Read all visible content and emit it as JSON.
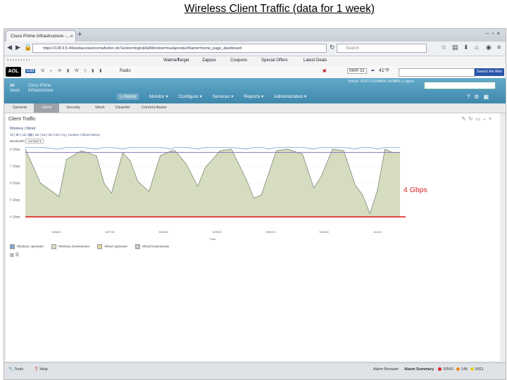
{
  "slide_title": "Wireless Client Traffic (data for 1 week)",
  "browser": {
    "tab_title": "Cisco Prime Infrastructure -...",
    "new_tab": "+",
    "url": "https://128.9.5.44/webacs/welcomeAction.do?action=login&failWindow=true&productName=home_page_dashboard",
    "search_placeholder": "Search"
  },
  "bookmarks": [
    "Walmart",
    "Target",
    "Zappos",
    "Coupons",
    "Special Offers",
    "Latest Deals"
  ],
  "aol_toolbar": {
    "logo": "AOL",
    "edit": "Edit",
    "radio": "Radio",
    "date": "MAR 31",
    "weather": "41°F",
    "search_button": "Search the Web"
  },
  "app_header": {
    "logo": "cisco",
    "product": "Cisco Prime Infrastructure",
    "user_info": "Virtual : ROOT-DOMAIN  |  ADMIN  |  Logout",
    "menu": [
      "Home",
      "Monitor",
      "Configure",
      "Services",
      "Reports",
      "Administration"
    ]
  },
  "subtabs": [
    "General",
    "Client",
    "Security",
    "Mesh",
    "CleanAir",
    "Context Aware"
  ],
  "panel": {
    "title": "Client Traffic",
    "filters": [
      "Wireless",
      "Wired"
    ],
    "periods": [
      "1h",
      "6h",
      "1d",
      "1w",
      "2w",
      "4w",
      "3m",
      "6m",
      "1y",
      "Custom",
      "Show history"
    ],
    "bandwidth_label": "Bandwidth",
    "bandwidth_value": "overlaid"
  },
  "chart_data": {
    "type": "area",
    "ylabels": [
      "8 Gbps",
      "7 Gbps",
      "6 Gbps",
      "5 Gbps",
      "4 Gbps"
    ],
    "x_ticks": [
      "3/26/13",
      "3/27/13",
      "3/28/13",
      "3/29/13",
      "3/30/13",
      "3/31/13",
      "4/1/13"
    ],
    "xlabel": "Time",
    "ylim": [
      3.8,
      8.2
    ],
    "x": [
      0,
      0.04,
      0.09,
      0.11,
      0.15,
      0.19,
      0.21,
      0.23,
      0.26,
      0.28,
      0.3,
      0.33,
      0.36,
      0.39,
      0.4,
      0.43,
      0.46,
      0.48,
      0.52,
      0.55,
      0.59,
      0.61,
      0.63,
      0.65,
      0.67,
      0.7,
      0.74,
      0.77,
      0.79,
      0.82,
      0.85,
      0.88,
      0.9,
      0.92,
      0.94,
      0.96,
      0.98,
      1.0
    ],
    "series": [
      {
        "name": "Wireless Upstream",
        "values": [
          8.0,
          6.0,
          5.2,
          7.4,
          7.9,
          7.6,
          6.0,
          5.4,
          7.8,
          7.3,
          6.1,
          5.5,
          7.6,
          7.9,
          7.9,
          7.1,
          5.8,
          6.9,
          7.9,
          8.0,
          6.2,
          5.1,
          5.3,
          6.6,
          7.9,
          8.0,
          7.7,
          5.7,
          6.4,
          8.0,
          7.9,
          5.9,
          5.3,
          4.2,
          5.6,
          8.0,
          7.8,
          7.8
        ]
      },
      {
        "name": "Wireless Downstream",
        "values": [
          7.8,
          7.8,
          7.8,
          7.8,
          7.8,
          7.8,
          7.8,
          7.8,
          7.8,
          7.8,
          7.8,
          7.8,
          7.8,
          7.8,
          7.8,
          7.8,
          7.8,
          7.8,
          7.8,
          7.8,
          7.8,
          7.8,
          7.8,
          7.8,
          7.8,
          7.8,
          7.8,
          7.8,
          7.8,
          7.8,
          7.8,
          7.8,
          7.8,
          7.8,
          7.8,
          7.8,
          7.8,
          7.8
        ]
      },
      {
        "name": "Wired Upstream",
        "values": [
          8.1,
          8.1,
          8.0,
          8.1,
          8.1,
          8.0,
          8.1,
          8.1,
          8.0,
          8.1,
          8.1,
          8.1,
          8.1,
          8.0,
          8.1,
          8.1,
          8.0,
          8.1,
          8.1,
          8.1,
          8.0,
          8.1,
          8.1,
          8.0,
          8.1,
          8.1,
          8.1,
          8.0,
          8.1,
          8.1,
          8.1,
          8.0,
          8.1,
          8.1,
          8.0,
          8.1,
          8.1,
          8.1
        ]
      },
      {
        "name": "Wired Downstream",
        "values": [
          4.0,
          4.0,
          4.0,
          4.0,
          4.0,
          4.0,
          4.0,
          4.0,
          4.0,
          4.0,
          4.0,
          4.0,
          4.0,
          4.0,
          4.0,
          4.0,
          4.0,
          4.0,
          4.0,
          4.0,
          4.0,
          4.0,
          4.0,
          4.0,
          4.0,
          4.0,
          4.0,
          4.0,
          4.0,
          4.0,
          4.0,
          4.0,
          4.0,
          4.0,
          4.0,
          4.0,
          4.0,
          4.0
        ]
      }
    ],
    "threshold": 4.0,
    "colors": {
      "fill": "#d6dcbf",
      "upper": "#7f9fcf",
      "downstream": "#8b74b8",
      "threshold": "#e02020"
    }
  },
  "legend": [
    "Wireless Upstream",
    "Wireless Downstream",
    "Wired Upstream",
    "Wired Downstream"
  ],
  "legend_colors": [
    "#7fa7d4",
    "#d6dcbf",
    "#e0d8a0",
    "#c8c8c8"
  ],
  "annotation": "4 Gbps",
  "status_bar": {
    "tools": "Tools",
    "help": "Help",
    "alarm_browser": "Alarm Browser",
    "alarm_summary": "Alarm Summary",
    "critical": "10541",
    "major": "146",
    "minor": "9921"
  }
}
